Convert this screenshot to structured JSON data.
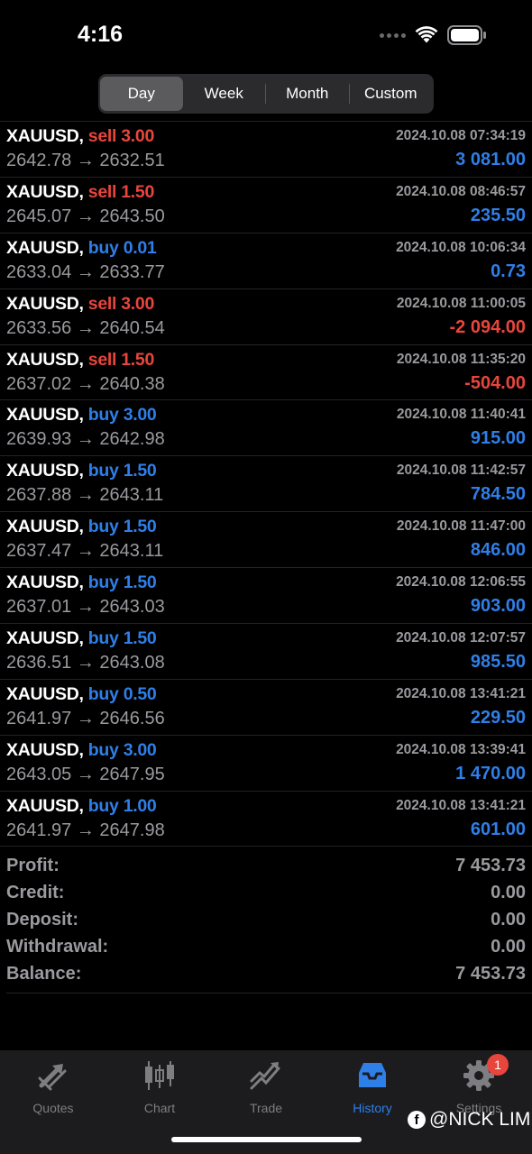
{
  "status_bar": {
    "time": "4:16"
  },
  "segmented": {
    "items": [
      "Day",
      "Week",
      "Month",
      "Custom"
    ],
    "active": "Day"
  },
  "trades": [
    {
      "symbol": "XAUUSD,",
      "side": "sell",
      "volume": "3.00",
      "time": "2024.10.08 07:34:19",
      "open": "2642.78",
      "close": "2632.51",
      "profit": "3 081.00",
      "negative": false
    },
    {
      "symbol": "XAUUSD,",
      "side": "sell",
      "volume": "1.50",
      "time": "2024.10.08 08:46:57",
      "open": "2645.07",
      "close": "2643.50",
      "profit": "235.50",
      "negative": false
    },
    {
      "symbol": "XAUUSD,",
      "side": "buy",
      "volume": "0.01",
      "time": "2024.10.08 10:06:34",
      "open": "2633.04",
      "close": "2633.77",
      "profit": "0.73",
      "negative": false
    },
    {
      "symbol": "XAUUSD,",
      "side": "sell",
      "volume": "3.00",
      "time": "2024.10.08 11:00:05",
      "open": "2633.56",
      "close": "2640.54",
      "profit": "-2 094.00",
      "negative": true
    },
    {
      "symbol": "XAUUSD,",
      "side": "sell",
      "volume": "1.50",
      "time": "2024.10.08 11:35:20",
      "open": "2637.02",
      "close": "2640.38",
      "profit": "-504.00",
      "negative": true
    },
    {
      "symbol": "XAUUSD,",
      "side": "buy",
      "volume": "3.00",
      "time": "2024.10.08 11:40:41",
      "open": "2639.93",
      "close": "2642.98",
      "profit": "915.00",
      "negative": false
    },
    {
      "symbol": "XAUUSD,",
      "side": "buy",
      "volume": "1.50",
      "time": "2024.10.08 11:42:57",
      "open": "2637.88",
      "close": "2643.11",
      "profit": "784.50",
      "negative": false
    },
    {
      "symbol": "XAUUSD,",
      "side": "buy",
      "volume": "1.50",
      "time": "2024.10.08 11:47:00",
      "open": "2637.47",
      "close": "2643.11",
      "profit": "846.00",
      "negative": false
    },
    {
      "symbol": "XAUUSD,",
      "side": "buy",
      "volume": "1.50",
      "time": "2024.10.08 12:06:55",
      "open": "2637.01",
      "close": "2643.03",
      "profit": "903.00",
      "negative": false
    },
    {
      "symbol": "XAUUSD,",
      "side": "buy",
      "volume": "1.50",
      "time": "2024.10.08 12:07:57",
      "open": "2636.51",
      "close": "2643.08",
      "profit": "985.50",
      "negative": false
    },
    {
      "symbol": "XAUUSD,",
      "side": "buy",
      "volume": "0.50",
      "time": "2024.10.08 13:41:21",
      "open": "2641.97",
      "close": "2646.56",
      "profit": "229.50",
      "negative": false
    },
    {
      "symbol": "XAUUSD,",
      "side": "buy",
      "volume": "3.00",
      "time": "2024.10.08 13:39:41",
      "open": "2643.05",
      "close": "2647.95",
      "profit": "1 470.00",
      "negative": false
    },
    {
      "symbol": "XAUUSD,",
      "side": "buy",
      "volume": "1.00",
      "time": "2024.10.08 13:41:21",
      "open": "2641.97",
      "close": "2647.98",
      "profit": "601.00",
      "negative": false
    }
  ],
  "arrow": "→",
  "summary": [
    {
      "label": "Profit:",
      "value": "7 453.73"
    },
    {
      "label": "Credit:",
      "value": "0.00"
    },
    {
      "label": "Deposit:",
      "value": "0.00"
    },
    {
      "label": "Withdrawal:",
      "value": "0.00"
    },
    {
      "label": "Balance:",
      "value": "7 453.73"
    }
  ],
  "tabbar": {
    "tabs": [
      {
        "label": "Quotes",
        "icon": "quotes-icon"
      },
      {
        "label": "Chart",
        "icon": "candlestick-icon"
      },
      {
        "label": "Trade",
        "icon": "trade-icon"
      },
      {
        "label": "History",
        "icon": "inbox-icon"
      },
      {
        "label": "Settings",
        "icon": "gear-icon"
      }
    ],
    "active": "History",
    "settings_badge": "1"
  },
  "watermark": {
    "text": "@NICK LIM",
    "icon_letter": "f"
  },
  "colors": {
    "sell": "#e8453c",
    "buy": "#2f7fe8",
    "muted": "#9a9a9f",
    "tab_inactive": "#7d7d82"
  }
}
